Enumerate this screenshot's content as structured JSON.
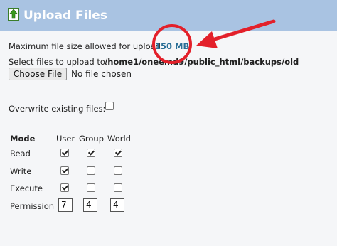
{
  "header": {
    "title": "Upload Files",
    "icon": "upload-arrow-icon"
  },
  "upload": {
    "max_size_label": "Maximum file size allowed for upload:",
    "max_size_value": "150 MB",
    "select_label": "Select files to upload to:",
    "target_path": "/home1/oneemd9/public_html/backups/old",
    "choose_button": "Choose File",
    "file_status": "No file chosen"
  },
  "overwrite": {
    "label": "Overwrite existing files:",
    "checked": false
  },
  "permissions": {
    "mode_header": "Mode",
    "columns": [
      "User",
      "Group",
      "World"
    ],
    "rows": [
      {
        "label": "Read",
        "checked": [
          true,
          true,
          true
        ]
      },
      {
        "label": "Write",
        "checked": [
          true,
          false,
          false
        ]
      },
      {
        "label": "Execute",
        "checked": [
          true,
          false,
          false
        ]
      }
    ],
    "permission_label": "Permission",
    "values": [
      "7",
      "4",
      "4"
    ]
  },
  "annotation": {
    "color": "#e3202a"
  },
  "colors": {
    "header_bg": "#a9c3e2",
    "size_value": "#2a6f97"
  }
}
